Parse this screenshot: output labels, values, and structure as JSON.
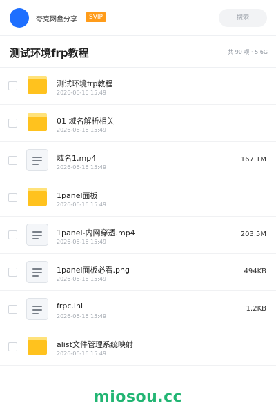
{
  "header": {
    "app_name": "夸克网盘分享",
    "badge": "SVIP",
    "search_placeholder": "搜索"
  },
  "folder": {
    "title": "测试环境frp教程",
    "stats": "共 90 项 · 5.6G"
  },
  "files": [
    {
      "name": "测试环境frp教程",
      "date": "2026-06-16 15:49",
      "size": "",
      "type": "folder"
    },
    {
      "name": "01 域名解析相关",
      "date": "2026-06-16 15:49",
      "size": "",
      "type": "folder"
    },
    {
      "name": "域名1.mp4",
      "date": "2026-06-16 15:49",
      "size": "167.1M",
      "type": "file"
    },
    {
      "name": "1panel面板",
      "date": "2026-06-16 15:49",
      "size": "",
      "type": "folder"
    },
    {
      "name": "1panel-内网穿透.mp4",
      "date": "2026-06-16 15:49",
      "size": "203.5M",
      "type": "file"
    },
    {
      "name": "1panel面板必看.png",
      "date": "2026-06-16 15:49",
      "size": "494KB",
      "type": "file"
    },
    {
      "name": "frpc.ini",
      "date": "2026-06-16 15:49",
      "size": "1.2KB",
      "type": "file"
    },
    {
      "name": "alist文件管理系统映射",
      "date": "2026-06-16 15:49",
      "size": "",
      "type": "folder"
    }
  ],
  "watermark": "miosou.cc",
  "colors": {
    "avatar": "#1e6fff",
    "badge": "#ff9c1a",
    "folder": "#ffc21e",
    "watermark": "#22b573"
  }
}
